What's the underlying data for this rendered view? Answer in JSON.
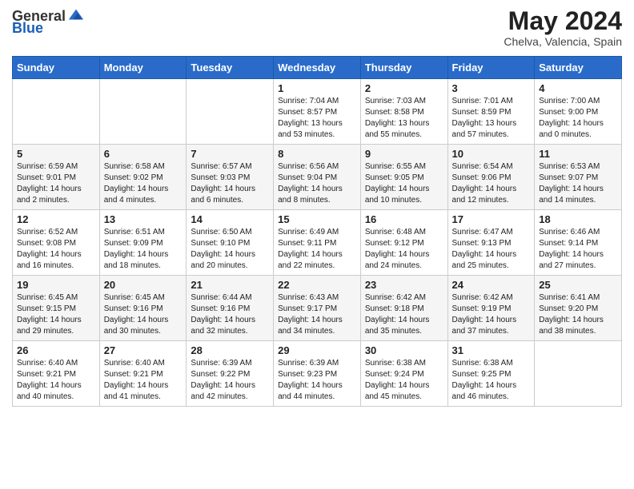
{
  "header": {
    "logo_general": "General",
    "logo_blue": "Blue",
    "month_year": "May 2024",
    "location": "Chelva, Valencia, Spain"
  },
  "days_of_week": [
    "Sunday",
    "Monday",
    "Tuesday",
    "Wednesday",
    "Thursday",
    "Friday",
    "Saturday"
  ],
  "weeks": [
    [
      {
        "day": "",
        "info": ""
      },
      {
        "day": "",
        "info": ""
      },
      {
        "day": "",
        "info": ""
      },
      {
        "day": "1",
        "info": "Sunrise: 7:04 AM\nSunset: 8:57 PM\nDaylight: 13 hours\nand 53 minutes."
      },
      {
        "day": "2",
        "info": "Sunrise: 7:03 AM\nSunset: 8:58 PM\nDaylight: 13 hours\nand 55 minutes."
      },
      {
        "day": "3",
        "info": "Sunrise: 7:01 AM\nSunset: 8:59 PM\nDaylight: 13 hours\nand 57 minutes."
      },
      {
        "day": "4",
        "info": "Sunrise: 7:00 AM\nSunset: 9:00 PM\nDaylight: 14 hours\nand 0 minutes."
      }
    ],
    [
      {
        "day": "5",
        "info": "Sunrise: 6:59 AM\nSunset: 9:01 PM\nDaylight: 14 hours\nand 2 minutes."
      },
      {
        "day": "6",
        "info": "Sunrise: 6:58 AM\nSunset: 9:02 PM\nDaylight: 14 hours\nand 4 minutes."
      },
      {
        "day": "7",
        "info": "Sunrise: 6:57 AM\nSunset: 9:03 PM\nDaylight: 14 hours\nand 6 minutes."
      },
      {
        "day": "8",
        "info": "Sunrise: 6:56 AM\nSunset: 9:04 PM\nDaylight: 14 hours\nand 8 minutes."
      },
      {
        "day": "9",
        "info": "Sunrise: 6:55 AM\nSunset: 9:05 PM\nDaylight: 14 hours\nand 10 minutes."
      },
      {
        "day": "10",
        "info": "Sunrise: 6:54 AM\nSunset: 9:06 PM\nDaylight: 14 hours\nand 12 minutes."
      },
      {
        "day": "11",
        "info": "Sunrise: 6:53 AM\nSunset: 9:07 PM\nDaylight: 14 hours\nand 14 minutes."
      }
    ],
    [
      {
        "day": "12",
        "info": "Sunrise: 6:52 AM\nSunset: 9:08 PM\nDaylight: 14 hours\nand 16 minutes."
      },
      {
        "day": "13",
        "info": "Sunrise: 6:51 AM\nSunset: 9:09 PM\nDaylight: 14 hours\nand 18 minutes."
      },
      {
        "day": "14",
        "info": "Sunrise: 6:50 AM\nSunset: 9:10 PM\nDaylight: 14 hours\nand 20 minutes."
      },
      {
        "day": "15",
        "info": "Sunrise: 6:49 AM\nSunset: 9:11 PM\nDaylight: 14 hours\nand 22 minutes."
      },
      {
        "day": "16",
        "info": "Sunrise: 6:48 AM\nSunset: 9:12 PM\nDaylight: 14 hours\nand 24 minutes."
      },
      {
        "day": "17",
        "info": "Sunrise: 6:47 AM\nSunset: 9:13 PM\nDaylight: 14 hours\nand 25 minutes."
      },
      {
        "day": "18",
        "info": "Sunrise: 6:46 AM\nSunset: 9:14 PM\nDaylight: 14 hours\nand 27 minutes."
      }
    ],
    [
      {
        "day": "19",
        "info": "Sunrise: 6:45 AM\nSunset: 9:15 PM\nDaylight: 14 hours\nand 29 minutes."
      },
      {
        "day": "20",
        "info": "Sunrise: 6:45 AM\nSunset: 9:16 PM\nDaylight: 14 hours\nand 30 minutes."
      },
      {
        "day": "21",
        "info": "Sunrise: 6:44 AM\nSunset: 9:16 PM\nDaylight: 14 hours\nand 32 minutes."
      },
      {
        "day": "22",
        "info": "Sunrise: 6:43 AM\nSunset: 9:17 PM\nDaylight: 14 hours\nand 34 minutes."
      },
      {
        "day": "23",
        "info": "Sunrise: 6:42 AM\nSunset: 9:18 PM\nDaylight: 14 hours\nand 35 minutes."
      },
      {
        "day": "24",
        "info": "Sunrise: 6:42 AM\nSunset: 9:19 PM\nDaylight: 14 hours\nand 37 minutes."
      },
      {
        "day": "25",
        "info": "Sunrise: 6:41 AM\nSunset: 9:20 PM\nDaylight: 14 hours\nand 38 minutes."
      }
    ],
    [
      {
        "day": "26",
        "info": "Sunrise: 6:40 AM\nSunset: 9:21 PM\nDaylight: 14 hours\nand 40 minutes."
      },
      {
        "day": "27",
        "info": "Sunrise: 6:40 AM\nSunset: 9:21 PM\nDaylight: 14 hours\nand 41 minutes."
      },
      {
        "day": "28",
        "info": "Sunrise: 6:39 AM\nSunset: 9:22 PM\nDaylight: 14 hours\nand 42 minutes."
      },
      {
        "day": "29",
        "info": "Sunrise: 6:39 AM\nSunset: 9:23 PM\nDaylight: 14 hours\nand 44 minutes."
      },
      {
        "day": "30",
        "info": "Sunrise: 6:38 AM\nSunset: 9:24 PM\nDaylight: 14 hours\nand 45 minutes."
      },
      {
        "day": "31",
        "info": "Sunrise: 6:38 AM\nSunset: 9:25 PM\nDaylight: 14 hours\nand 46 minutes."
      },
      {
        "day": "",
        "info": ""
      }
    ]
  ]
}
